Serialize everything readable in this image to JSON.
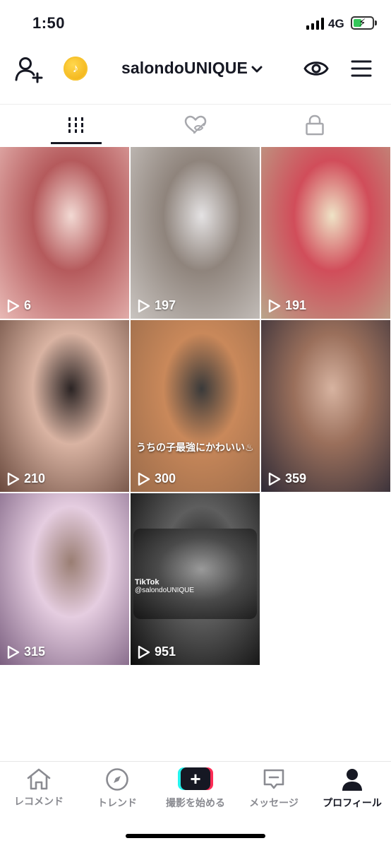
{
  "status_bar": {
    "time": "1:50",
    "network": "4G",
    "battery_level": 0.45,
    "charging": true
  },
  "header": {
    "username": "salondoUNIQUE",
    "coin_symbol": "♪"
  },
  "tabs": [
    {
      "name": "videos-tab",
      "icon": "grid-icon",
      "active": true
    },
    {
      "name": "liked-tab",
      "icon": "hidden-heart-icon",
      "active": false
    },
    {
      "name": "private-tab",
      "icon": "lock-icon",
      "active": false
    }
  ],
  "videos": [
    {
      "views": "6",
      "colors": [
        "#e8b9b5",
        "#b55a5c",
        "#f2d9d3"
      ]
    },
    {
      "views": "197",
      "colors": [
        "#c9c4c0",
        "#8f847c",
        "#e4e2e3"
      ]
    },
    {
      "views": "191",
      "colors": [
        "#b9a58a",
        "#d14d5a",
        "#efe3c6"
      ]
    },
    {
      "views": "210",
      "colors": [
        "#6a4a3e",
        "#d9b3a2",
        "#2b2424"
      ]
    },
    {
      "views": "300",
      "colors": [
        "#9a6b4a",
        "#c9885a",
        "#3a3a3a"
      ],
      "caption": "うちの子最強にかわいい♨"
    },
    {
      "views": "359",
      "colors": [
        "#2e2a36",
        "#9a6f5b",
        "#d7b3a0"
      ]
    },
    {
      "views": "315",
      "colors": [
        "#7b5f80",
        "#e5cde0",
        "#9a7e73"
      ]
    },
    {
      "views": "951",
      "colors": [
        "#0c0c0c",
        "#5e5e5e",
        "#1a1a1a"
      ],
      "tiktok_label": "TikTok",
      "tiktok_user": "@salondoUNIQUE"
    }
  ],
  "bottom_nav": [
    {
      "label": "レコメンド",
      "icon": "home-icon"
    },
    {
      "label": "トレンド",
      "icon": "compass-icon"
    },
    {
      "label": "撮影を始める",
      "icon": "create-plus-icon"
    },
    {
      "label": "メッセージ",
      "icon": "inbox-icon"
    },
    {
      "label": "プロフィール",
      "icon": "profile-icon",
      "active": true
    }
  ]
}
